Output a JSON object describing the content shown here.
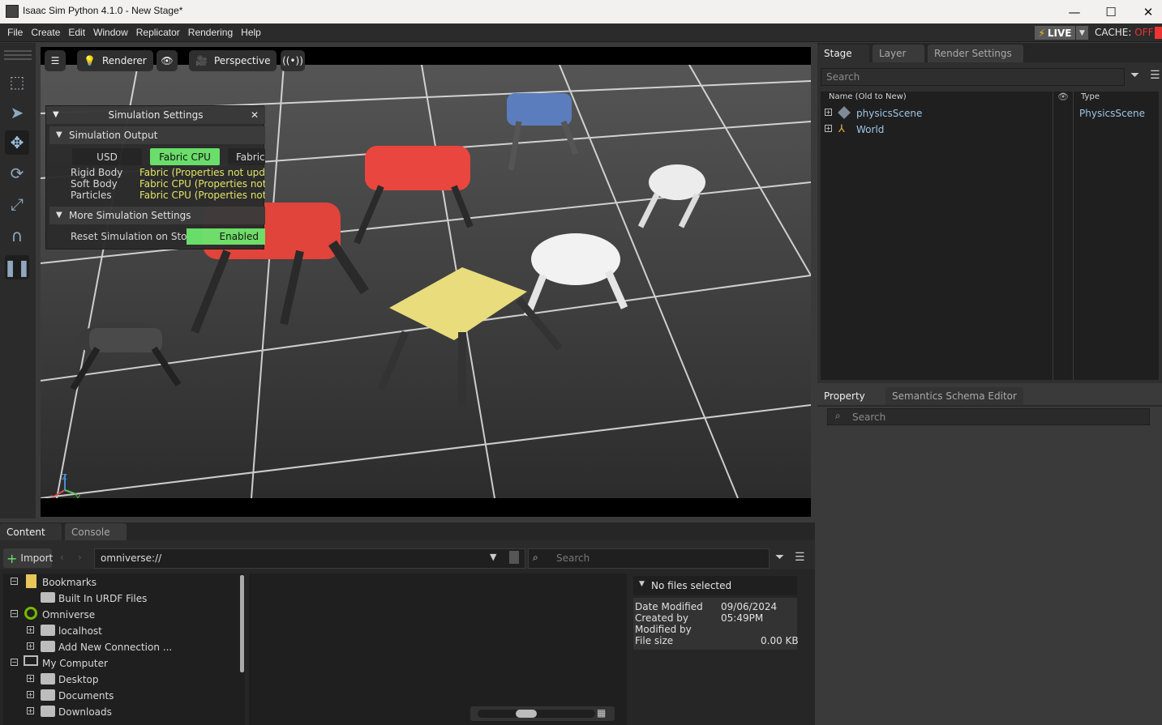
{
  "window": {
    "title": "Isaac Sim Python 4.1.0 - New Stage*",
    "minimize": "—",
    "maximize": "☐",
    "close": "✕"
  },
  "menubar": {
    "items": [
      "File",
      "Create",
      "Edit",
      "Window",
      "Replicator",
      "Rendering",
      "Help"
    ]
  },
  "status": {
    "live_label": "LIVE",
    "cache_label": "CACHE:",
    "cache_value": "OFF"
  },
  "viewport_toolbar": {
    "renderer": "Renderer",
    "camera": "Perspective"
  },
  "sim_settings": {
    "title": "Simulation Settings",
    "output_section": "Simulation Output",
    "buttons": [
      "USD",
      "Fabric CPU",
      "Fabric"
    ],
    "rows": [
      {
        "label": "Rigid Body",
        "value_a": "Fabric",
        "value_b": "(Properties not update"
      },
      {
        "label": "Soft Body",
        "value_a": "Fabric CPU",
        "value_b": "(Properties not u"
      },
      {
        "label": "Particles",
        "value_a": "Fabric CPU",
        "value_b": "(Properties not u"
      }
    ],
    "more_section": "More Simulation Settings",
    "reset_label": "Reset Simulation on Stop",
    "reset_value": "Enabled"
  },
  "axis": {
    "z": "Z",
    "x": "X",
    "y": "Y"
  },
  "stage": {
    "tabs": [
      "Stage",
      "Layer",
      "Render Settings"
    ],
    "search_placeholder": "Search",
    "col_name": "Name (Old to New)",
    "col_type": "Type",
    "items": [
      {
        "name": "physicsScene",
        "type": "PhysicsScene"
      },
      {
        "name": "World",
        "type": ""
      }
    ]
  },
  "property": {
    "tabs": [
      "Property",
      "Semantics Schema Editor"
    ],
    "search_placeholder": "Search"
  },
  "content": {
    "tabs": [
      "Content",
      "Console"
    ],
    "import_label": "Import",
    "path": "omniverse://",
    "search_placeholder": "Search",
    "tree": [
      {
        "label": "Bookmarks"
      },
      {
        "label": "Built In URDF Files"
      },
      {
        "label": "Omniverse"
      },
      {
        "label": "localhost"
      },
      {
        "label": "Add New Connection ..."
      },
      {
        "label": "My Computer"
      },
      {
        "label": "Desktop"
      },
      {
        "label": "Documents"
      },
      {
        "label": "Downloads"
      }
    ],
    "details": {
      "header": "No files selected",
      "date_label": "Date Modified",
      "date_value": "09/06/2024 05:49PM",
      "created_label": "Created by",
      "modified_label": "Modified by",
      "size_label": "File size",
      "size_value": "0.00 KB"
    }
  },
  "colors": {
    "accent_green": "#6be26b",
    "cache_off": "#e33333",
    "live_bolt": "#f0c020"
  }
}
